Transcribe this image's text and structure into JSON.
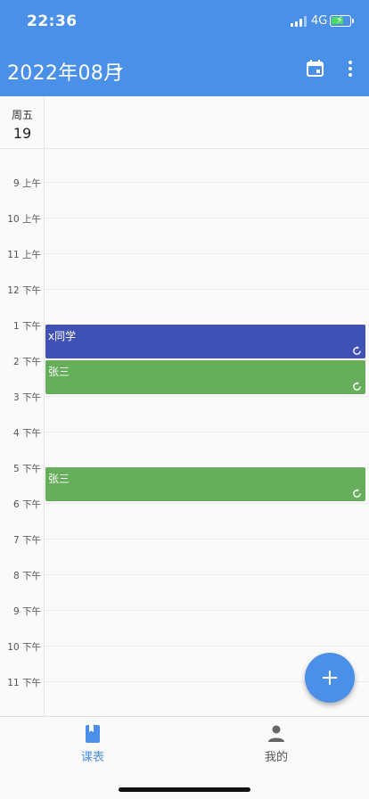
{
  "status_bar": {
    "time": "22:36",
    "network": "4G"
  },
  "header": {
    "month_title": "2022年08月",
    "accent_color": "#4a90e8"
  },
  "day": {
    "weekday": "周五",
    "date": "19"
  },
  "hours": [
    "9 上午",
    "10 上午",
    "11 上午",
    "12 下午",
    "1 下午",
    "2 下午",
    "3 下午",
    "4 下午",
    "5 下午",
    "6 下午",
    "7 下午",
    "8 下午",
    "9 下午",
    "10 下午",
    "11 下午"
  ],
  "events": [
    {
      "title": "x同学",
      "color": "#3f51b5",
      "icon": "repeat-icon"
    },
    {
      "title": "张三",
      "color": "#66ad5c",
      "icon": "repeat-icon"
    },
    {
      "title": "张三",
      "color": "#66ad5c",
      "icon": "repeat-icon"
    }
  ],
  "bottom_nav": {
    "schedule_label": "课表",
    "mine_label": "我的"
  }
}
